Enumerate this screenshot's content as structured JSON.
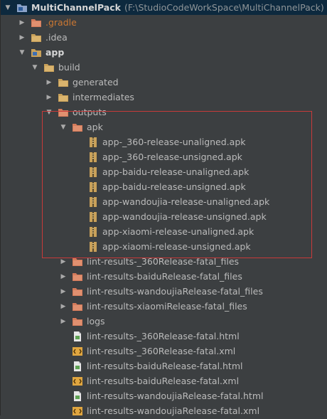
{
  "project": {
    "name": "MultiChannelPack",
    "path": "(F:\\StudioCodeWorkSpace\\MultiChannelPack)"
  },
  "folders_top": [
    ".gradle",
    ".idea"
  ],
  "app": {
    "label": "app",
    "build": {
      "label": "build",
      "generated": "generated",
      "intermediates": "intermediates",
      "outputs": {
        "label": "outputs",
        "apk": {
          "label": "apk",
          "files": [
            "app-_360-release-unaligned.apk",
            "app-_360-release-unsigned.apk",
            "app-baidu-release-unaligned.apk",
            "app-baidu-release-unsigned.apk",
            "app-wandoujia-release-unaligned.apk",
            "app-wandoujia-release-unsigned.apk",
            "app-xiaomi-release-unaligned.apk",
            "app-xiaomi-release-unsigned.apk"
          ]
        },
        "lint_folders": [
          "lint-results-_360Release-fatal_files",
          "lint-results-baiduRelease-fatal_files",
          "lint-results-wandoujiaRelease-fatal_files",
          "lint-results-xiaomiRelease-fatal_files"
        ],
        "logs": "logs",
        "lint_files": [
          "lint-results-_360Release-fatal.html",
          "lint-results-_360Release-fatal.xml",
          "lint-results-baiduRelease-fatal.html",
          "lint-results-baiduRelease-fatal.xml",
          "lint-results-wandoujiaRelease-fatal.html",
          "lint-results-wandoujiaRelease-fatal.xml"
        ]
      }
    }
  },
  "colors": {
    "background": "#3c3f41",
    "folder": "#c9a15a",
    "folder_excluded": "#d47a5a",
    "highlight_box": "#c83a3a",
    "selected_row": "#0d293e"
  },
  "icons": {
    "expanded": "triangle-down",
    "collapsed": "triangle-right",
    "folder": "folder-icon",
    "module": "module-folder-icon",
    "apk": "archive-icon",
    "html": "html-file-icon",
    "xml": "xml-file-icon"
  }
}
